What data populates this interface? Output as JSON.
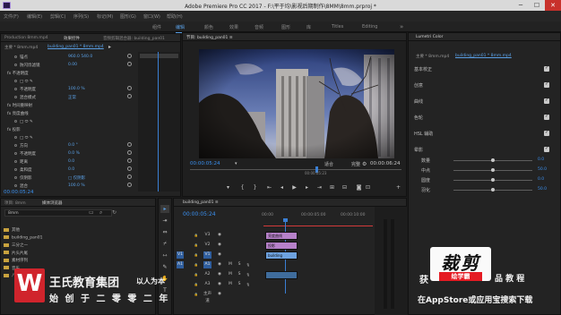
{
  "window": {
    "app_title": "Adobe Premiere Pro CC 2017",
    "path": "F:\\平于均\\影视后期制作\\8MM\\8mm.prproj *",
    "minimize": "─",
    "maximize": "☐",
    "close": "✕"
  },
  "menu": [
    "文件(F)",
    "编辑(E)",
    "剪辑(C)",
    "序列(S)",
    "标记(M)",
    "图形(G)",
    "窗口(W)",
    "帮助(H)"
  ],
  "workspaces": [
    {
      "label": "组件",
      "active": false
    },
    {
      "label": "编辑",
      "active": true
    },
    {
      "label": "颜色",
      "active": false
    },
    {
      "label": "效果",
      "active": false
    },
    {
      "label": "音频",
      "active": false
    },
    {
      "label": "图形",
      "active": false
    },
    {
      "label": "库",
      "active": false
    },
    {
      "label": "Titles",
      "active": false
    },
    {
      "label": "Editing",
      "active": false
    }
  ],
  "effect_controls": {
    "tabs": [
      {
        "label": "Production 8mm.mp4",
        "active": false
      },
      {
        "label": "效果控件",
        "active": true
      },
      {
        "label": "音频剪辑混合器: building_pan01",
        "active": false
      }
    ],
    "source_label": "主要 * 8mm.mp4",
    "clip_label": "building_pan01 * 8mm.mp4",
    "rows": [
      {
        "label": "锚点",
        "value": "960.0  540.0"
      },
      {
        "label": "防闪烁滤镜",
        "value": "0.00"
      },
      {
        "label": "fx 不透明度",
        "value": ""
      },
      {
        "label": "□ ⬭ ✎",
        "value": ""
      },
      {
        "label": "不透明度",
        "value": "100.0 %"
      },
      {
        "label": "混合模式",
        "value": "正常"
      },
      {
        "label": "fx 时间重映射",
        "value": ""
      },
      {
        "label": "fx 亮度曲线",
        "value": ""
      },
      {
        "label": "□ ⬭ ✎",
        "value": ""
      },
      {
        "label": "fx 投影",
        "value": ""
      },
      {
        "label": "□ ⬭ ✎",
        "value": ""
      },
      {
        "label": "方向",
        "value": "0.0 °"
      },
      {
        "label": "不透明度",
        "value": "0.0 %"
      },
      {
        "label": "距离",
        "value": "0.0"
      },
      {
        "label": "柔和度",
        "value": "0.0"
      },
      {
        "label": "仅阴影",
        "value": "□ 仅阴影"
      },
      {
        "label": "混合",
        "value": "100.0 %"
      }
    ],
    "timecode": "00:00:05:24"
  },
  "program_monitor": {
    "tab": "节目: building_pan01 ≡",
    "timecode_left": "00:00:05:24",
    "fit": "适合",
    "quality": "完整",
    "timecode_right": "00:00:06:24",
    "ruler_tc": "00:00:05:23"
  },
  "lumetri": {
    "tab": "Lumetri Color",
    "source": "主要 * 8mm.mp4",
    "clip": "building_pan01 * 8mm.mp4",
    "sections": [
      "基本校正",
      "创意",
      "曲线",
      "色轮",
      "HSL 辅助",
      "晕影"
    ],
    "sliders": [
      {
        "label": "数量",
        "value": "0.0",
        "pos": 0.5
      },
      {
        "label": "中点",
        "value": "50.0",
        "pos": 0.5
      },
      {
        "label": "圆度",
        "value": "0.0",
        "pos": 0.5
      },
      {
        "label": "羽化",
        "value": "50.0",
        "pos": 0.5
      }
    ]
  },
  "project": {
    "tabs": [
      {
        "label": "项目: 8mm",
        "active": false
      },
      {
        "label": "媒体浏览器",
        "active": true
      }
    ],
    "path": "8mm",
    "items": [
      "其他",
      "building_pan01",
      "三分之一",
      "片头片尾",
      "素材序列",
      "音乐",
      "八分钟"
    ]
  },
  "timeline": {
    "tab": "building_pan01 ≡",
    "timecode": "00:00:05:24",
    "ruler": [
      "00:00",
      "00:00:05:00",
      "00:00:10:00",
      "00:00:15:00"
    ],
    "tracks": [
      {
        "id": "V3",
        "blue": false
      },
      {
        "id": "V2",
        "blue": false
      },
      {
        "id": "V1",
        "blue": true
      },
      {
        "id": "A1",
        "blue": true
      },
      {
        "id": "A2",
        "blue": false
      },
      {
        "id": "A3",
        "blue": false
      },
      {
        "id": "主声道",
        "blue": false
      }
    ],
    "clips": [
      {
        "label": "亮度曲线",
        "color": "#b681c9"
      },
      {
        "label": "投影",
        "color": "#b681c9"
      },
      {
        "label": "building",
        "color": "#6ea2df"
      },
      {
        "label": "",
        "color": "#3f6c9c"
      }
    ]
  },
  "tools": [
    "▸",
    "⇥",
    "⇔",
    "⌿",
    "⇿",
    "✎",
    "✋",
    "T"
  ],
  "overlay": {
    "logo_letter": "W",
    "company": "王氏教育集团",
    "slogan": "以人为本",
    "founded": "始 创 于 二 零 零 二 年",
    "ad_title": "裁剪",
    "ad_sub": "绘学霸",
    "left_tail": "获",
    "right_line1": "品 教 程",
    "right_line2": "在AppStore或应用宝搜索下载"
  }
}
